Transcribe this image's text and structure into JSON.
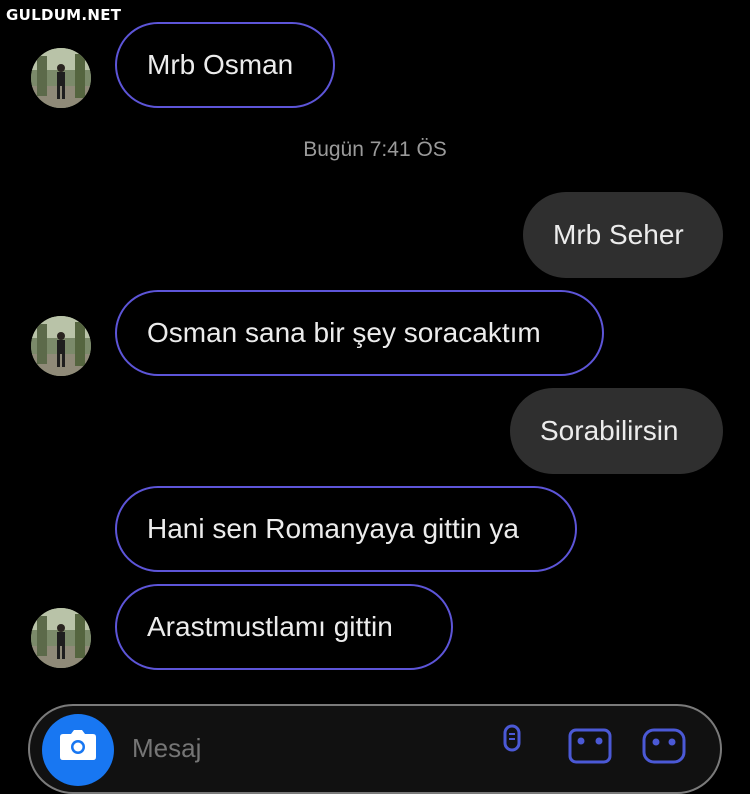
{
  "watermark": "GULDUM.NET",
  "timestamp": "Bugün 7:41 ÖS",
  "messages": [
    {
      "direction": "incoming",
      "text": "Mrb Osman"
    },
    {
      "direction": "outgoing",
      "text": "Mrb Seher"
    },
    {
      "direction": "incoming",
      "text": "Osman sana bir şey soracaktım"
    },
    {
      "direction": "outgoing",
      "text": "Sorabilirsin"
    },
    {
      "direction": "incoming",
      "text": "Hani sen Romanyaya gittin ya"
    },
    {
      "direction": "incoming",
      "text": "Arastmustlamı gittin"
    }
  ],
  "composer": {
    "placeholder": "Mesaj",
    "icons": [
      "camera-icon",
      "microphone-icon",
      "gallery-icon",
      "sticker-icon"
    ]
  },
  "colors": {
    "background": "#000000",
    "incoming_border": "#5d55d8",
    "outgoing_bubble": "#2f2f2f",
    "accent": "#1877f2"
  }
}
